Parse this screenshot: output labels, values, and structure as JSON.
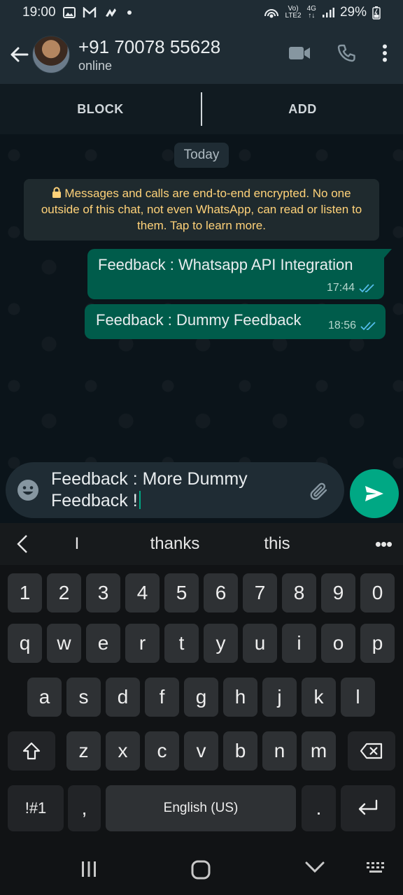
{
  "status_bar": {
    "time": "19:00",
    "volte_top": "Vo)",
    "volte_bottom": "LTE2",
    "network_top": "4G",
    "network_bottom": "↑↓",
    "battery_percent": "29%"
  },
  "header": {
    "contact_name": "+91 70078 55628",
    "contact_status": "online"
  },
  "action_bar": {
    "block_label": "BLOCK",
    "add_label": "ADD"
  },
  "chat": {
    "date_chip": "Today",
    "encryption_notice": "Messages and calls are end-to-end encrypted. No one outside of this chat, not even WhatsApp, can read or listen to them. Tap to learn more.",
    "messages": [
      {
        "text": "Feedback : Whatsapp API Integration",
        "time": "17:44",
        "status": "read"
      },
      {
        "text": "Feedback : Dummy Feedback",
        "time": "18:56",
        "status": "read"
      }
    ]
  },
  "composer": {
    "value_line1": "Feedback : More Dummy",
    "value_line2": "Feedback !"
  },
  "keyboard": {
    "suggestions": [
      "I",
      "thanks",
      "this"
    ],
    "more": "•••",
    "number_row": [
      "1",
      "2",
      "3",
      "4",
      "5",
      "6",
      "7",
      "8",
      "9",
      "0"
    ],
    "row1": [
      "q",
      "w",
      "e",
      "r",
      "t",
      "y",
      "u",
      "i",
      "o",
      "p"
    ],
    "row2": [
      "a",
      "s",
      "d",
      "f",
      "g",
      "h",
      "j",
      "k",
      "l"
    ],
    "row3": [
      "z",
      "x",
      "c",
      "v",
      "b",
      "n",
      "m"
    ],
    "symbols_key": "!#1",
    "comma_key": ",",
    "space_label": "English (US)",
    "period_key": "."
  },
  "colors": {
    "accent": "#00a884",
    "outgoing_bubble": "#005c4b",
    "header_bg": "#1f2c34",
    "encryption_text": "#ffd279",
    "read_ticks": "#53bdeb"
  },
  "icons": [
    "back-arrow-icon",
    "video-call-icon",
    "voice-call-icon",
    "more-options-icon",
    "lock-icon",
    "double-check-icon",
    "emoji-icon",
    "attach-icon",
    "send-icon",
    "chevron-left-icon",
    "shift-icon",
    "backspace-icon",
    "enter-icon",
    "recents-icon",
    "home-icon",
    "back-nav-icon",
    "keyboard-icon"
  ]
}
